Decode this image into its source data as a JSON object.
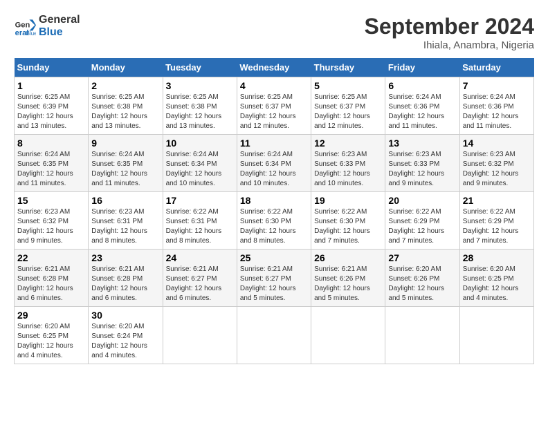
{
  "logo": {
    "line1": "General",
    "line2": "Blue"
  },
  "title": "September 2024",
  "location": "Ihiala, Anambra, Nigeria",
  "headers": [
    "Sunday",
    "Monday",
    "Tuesday",
    "Wednesday",
    "Thursday",
    "Friday",
    "Saturday"
  ],
  "weeks": [
    [
      {
        "day": "1",
        "sunrise": "6:25 AM",
        "sunset": "6:39 PM",
        "daylight": "12 hours and 13 minutes."
      },
      {
        "day": "2",
        "sunrise": "6:25 AM",
        "sunset": "6:38 PM",
        "daylight": "12 hours and 13 minutes."
      },
      {
        "day": "3",
        "sunrise": "6:25 AM",
        "sunset": "6:38 PM",
        "daylight": "12 hours and 13 minutes."
      },
      {
        "day": "4",
        "sunrise": "6:25 AM",
        "sunset": "6:37 PM",
        "daylight": "12 hours and 12 minutes."
      },
      {
        "day": "5",
        "sunrise": "6:25 AM",
        "sunset": "6:37 PM",
        "daylight": "12 hours and 12 minutes."
      },
      {
        "day": "6",
        "sunrise": "6:24 AM",
        "sunset": "6:36 PM",
        "daylight": "12 hours and 11 minutes."
      },
      {
        "day": "7",
        "sunrise": "6:24 AM",
        "sunset": "6:36 PM",
        "daylight": "12 hours and 11 minutes."
      }
    ],
    [
      {
        "day": "8",
        "sunrise": "6:24 AM",
        "sunset": "6:35 PM",
        "daylight": "12 hours and 11 minutes."
      },
      {
        "day": "9",
        "sunrise": "6:24 AM",
        "sunset": "6:35 PM",
        "daylight": "12 hours and 11 minutes."
      },
      {
        "day": "10",
        "sunrise": "6:24 AM",
        "sunset": "6:34 PM",
        "daylight": "12 hours and 10 minutes."
      },
      {
        "day": "11",
        "sunrise": "6:24 AM",
        "sunset": "6:34 PM",
        "daylight": "12 hours and 10 minutes."
      },
      {
        "day": "12",
        "sunrise": "6:23 AM",
        "sunset": "6:33 PM",
        "daylight": "12 hours and 10 minutes."
      },
      {
        "day": "13",
        "sunrise": "6:23 AM",
        "sunset": "6:33 PM",
        "daylight": "12 hours and 9 minutes."
      },
      {
        "day": "14",
        "sunrise": "6:23 AM",
        "sunset": "6:32 PM",
        "daylight": "12 hours and 9 minutes."
      }
    ],
    [
      {
        "day": "15",
        "sunrise": "6:23 AM",
        "sunset": "6:32 PM",
        "daylight": "12 hours and 9 minutes."
      },
      {
        "day": "16",
        "sunrise": "6:23 AM",
        "sunset": "6:31 PM",
        "daylight": "12 hours and 8 minutes."
      },
      {
        "day": "17",
        "sunrise": "6:22 AM",
        "sunset": "6:31 PM",
        "daylight": "12 hours and 8 minutes."
      },
      {
        "day": "18",
        "sunrise": "6:22 AM",
        "sunset": "6:30 PM",
        "daylight": "12 hours and 8 minutes."
      },
      {
        "day": "19",
        "sunrise": "6:22 AM",
        "sunset": "6:30 PM",
        "daylight": "12 hours and 7 minutes."
      },
      {
        "day": "20",
        "sunrise": "6:22 AM",
        "sunset": "6:29 PM",
        "daylight": "12 hours and 7 minutes."
      },
      {
        "day": "21",
        "sunrise": "6:22 AM",
        "sunset": "6:29 PM",
        "daylight": "12 hours and 7 minutes."
      }
    ],
    [
      {
        "day": "22",
        "sunrise": "6:21 AM",
        "sunset": "6:28 PM",
        "daylight": "12 hours and 6 minutes."
      },
      {
        "day": "23",
        "sunrise": "6:21 AM",
        "sunset": "6:28 PM",
        "daylight": "12 hours and 6 minutes."
      },
      {
        "day": "24",
        "sunrise": "6:21 AM",
        "sunset": "6:27 PM",
        "daylight": "12 hours and 6 minutes."
      },
      {
        "day": "25",
        "sunrise": "6:21 AM",
        "sunset": "6:27 PM",
        "daylight": "12 hours and 5 minutes."
      },
      {
        "day": "26",
        "sunrise": "6:21 AM",
        "sunset": "6:26 PM",
        "daylight": "12 hours and 5 minutes."
      },
      {
        "day": "27",
        "sunrise": "6:20 AM",
        "sunset": "6:26 PM",
        "daylight": "12 hours and 5 minutes."
      },
      {
        "day": "28",
        "sunrise": "6:20 AM",
        "sunset": "6:25 PM",
        "daylight": "12 hours and 4 minutes."
      }
    ],
    [
      {
        "day": "29",
        "sunrise": "6:20 AM",
        "sunset": "6:25 PM",
        "daylight": "12 hours and 4 minutes."
      },
      {
        "day": "30",
        "sunrise": "6:20 AM",
        "sunset": "6:24 PM",
        "daylight": "12 hours and 4 minutes."
      },
      null,
      null,
      null,
      null,
      null
    ]
  ]
}
